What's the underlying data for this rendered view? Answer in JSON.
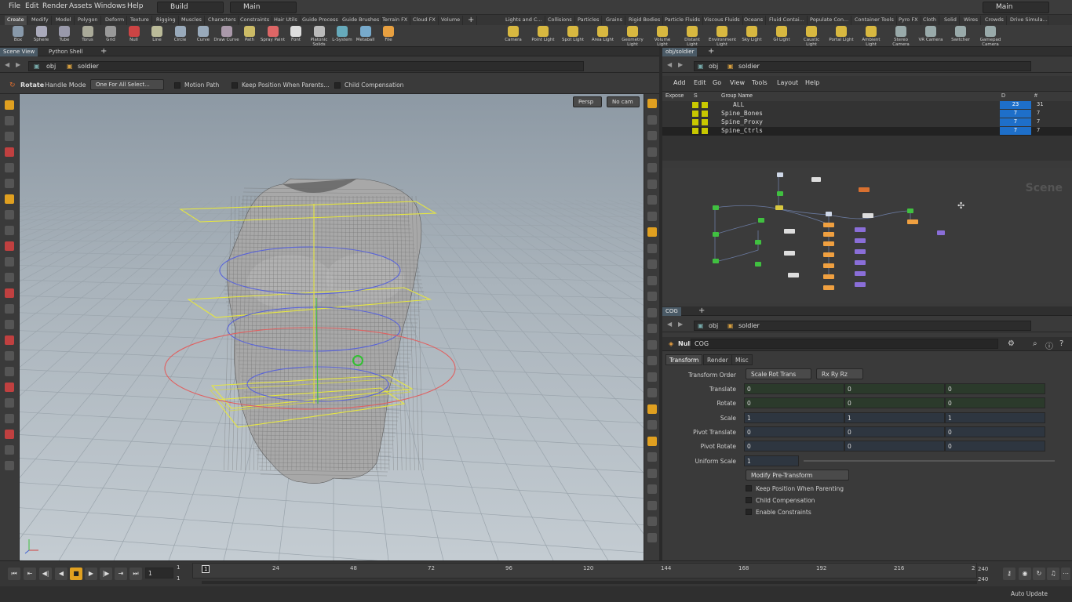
{
  "menubar": {
    "items": [
      "File",
      "Edit",
      "Render",
      "Assets",
      "Windows",
      "Help"
    ],
    "desktop": "Build",
    "context": "Main",
    "right_context": "Main"
  },
  "shelf": {
    "left_tabs": [
      "Create",
      "Modify",
      "Model",
      "Polygon",
      "Deform",
      "Texture",
      "Rigging",
      "Muscles",
      "Characters",
      "Constraints",
      "Hair Utils",
      "Guide Process",
      "Guide Brushes",
      "Terrain FX",
      "Cloud FX",
      "Volume"
    ],
    "right_tabs": [
      "Lights and C...",
      "Collisions",
      "Particles",
      "Grains",
      "Rigid Bodies",
      "Particle Fluids",
      "Viscous Fluids",
      "Oceans",
      "Fluid Contai...",
      "Populate Con...",
      "Container Tools",
      "Pyro FX",
      "Cloth",
      "Solid",
      "Wires",
      "Crowds",
      "Drive Simula..."
    ],
    "left_tools": [
      "Box",
      "Sphere",
      "Tube",
      "Torus",
      "Grid",
      "Null",
      "Line",
      "Circle",
      "Curve",
      "Draw Curve",
      "Path",
      "Spray Paint",
      "Font",
      "Platonic Solids",
      "L-System",
      "Metaball",
      "File"
    ],
    "right_tools": [
      "Camera",
      "Point Light",
      "Spot Light",
      "Area Light",
      "Geometry Light",
      "Volume Light",
      "Distant Light",
      "Environment Light",
      "Sky Light",
      "GI Light",
      "Caustic Light",
      "Portal Light",
      "Ambient Light",
      "Stereo Camera",
      "VR Camera",
      "Switcher",
      "Gamepad Camera"
    ]
  },
  "scene_view": {
    "tabs": [
      "Scene View",
      "Python Shell"
    ],
    "path": [
      "obj",
      "soldier"
    ],
    "op": {
      "name": "Rotate",
      "mode_label": "Handle Mode",
      "select": "One For All Select...",
      "motion_path": "Motion Path",
      "keep_position": "Keep Position When Parents...",
      "child_comp": "Child Compensation"
    },
    "persp": "Persp",
    "cam": "No cam"
  },
  "network": {
    "tab": "obj/soldier",
    "path": [
      "obj",
      "soldier"
    ],
    "menu": [
      "Add",
      "Edit",
      "Go",
      "View",
      "Tools",
      "Layout",
      "Help"
    ],
    "columns": {
      "expose": "Expose",
      "s": "S",
      "group_name": "Group Name",
      "d": "D",
      "hash": "#"
    },
    "groups": [
      {
        "name": "ALL",
        "d": "23",
        "n": "31"
      },
      {
        "name": "Spine_Bones",
        "d": "7",
        "n": "7"
      },
      {
        "name": "Spine_Proxy",
        "d": "7",
        "n": "7"
      },
      {
        "name": "Spine_Ctrls",
        "d": "7",
        "n": "7"
      }
    ],
    "watermark": "Scene"
  },
  "params": {
    "tab": "COG",
    "path": [
      "obj",
      "soldier"
    ],
    "node_type": "Null",
    "node_name": "COG",
    "tabs": [
      "Transform",
      "Render",
      "Misc"
    ],
    "transform_order_label": "Transform Order",
    "transform_order": "Scale Rot Trans",
    "rot_order": "Rx Ry Rz",
    "rows": [
      {
        "label": "Translate",
        "x": "0",
        "y": "0",
        "z": "0"
      },
      {
        "label": "Rotate",
        "x": "0",
        "y": "0",
        "z": "0"
      },
      {
        "label": "Scale",
        "x": "1",
        "y": "1",
        "z": "1"
      },
      {
        "label": "Pivot Translate",
        "x": "0",
        "y": "0",
        "z": "0"
      },
      {
        "label": "Pivot Rotate",
        "x": "0",
        "y": "0",
        "z": "0"
      }
    ],
    "uniform_label": "Uniform Scale",
    "uniform_value": "1",
    "modify_btn": "Modify Pre-Transform",
    "checks": [
      "Keep Position When Parenting",
      "Child Compensation",
      "Enable Constraints"
    ]
  },
  "timeline": {
    "frame": "1",
    "start": "1",
    "start2": "1",
    "ticks": [
      "1",
      "24",
      "48",
      "72",
      "96",
      "120",
      "144",
      "168",
      "192",
      "216",
      "2"
    ],
    "end": "240",
    "end2": "240"
  },
  "status": {
    "auto_update": "Auto Update"
  },
  "colors": {
    "accent": "#1e6fc9",
    "yellow": "#c8c800",
    "orange": "#e8a040"
  }
}
